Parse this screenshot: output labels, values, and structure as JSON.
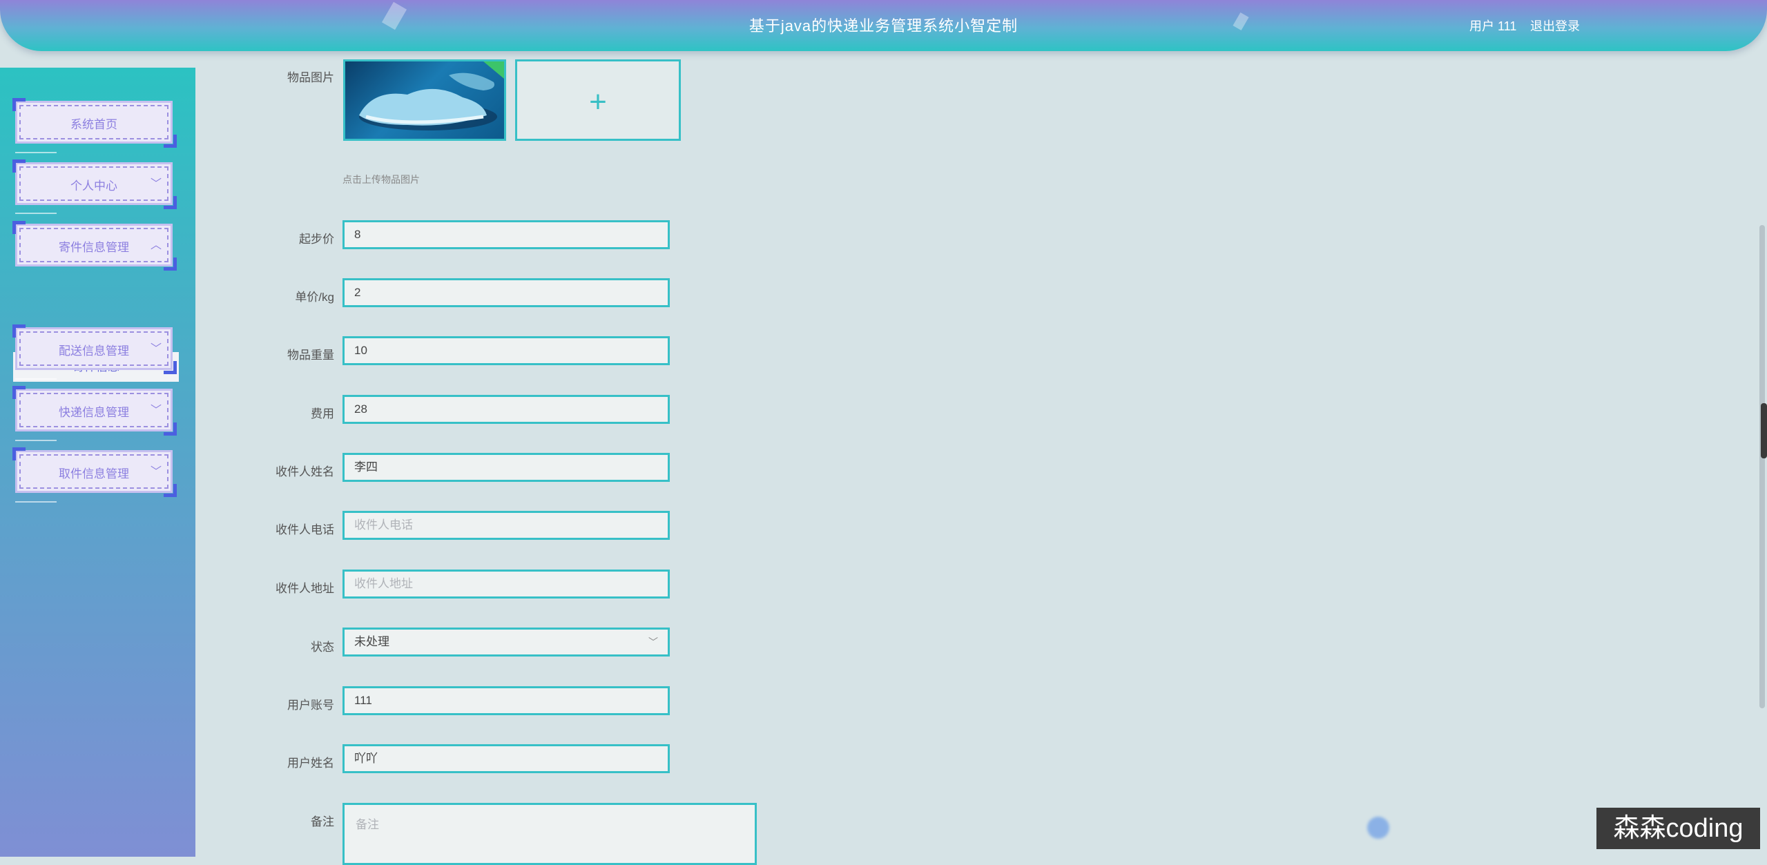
{
  "header": {
    "title": "基于java的快递业务管理系统小智定制",
    "user": "用户 111",
    "logout": "退出登录"
  },
  "sidebar": {
    "items": [
      {
        "label": "系统首页"
      },
      {
        "label": "个人中心",
        "chevron": "chevron-down-icon"
      },
      {
        "label": "寄件信息管理",
        "chevron": "chevron-up-icon"
      },
      {
        "label": "配送信息管理",
        "chevron": "chevron-down-icon"
      },
      {
        "label": "快递信息管理",
        "chevron": "chevron-down-icon"
      },
      {
        "label": "取件信息管理",
        "chevron": "chevron-down-icon"
      }
    ],
    "submenu": "寄件信息"
  },
  "form": {
    "image_label": "物品图片",
    "upload_hint": "点击上传物品图片",
    "upload_icon": "plus-icon",
    "fields": [
      {
        "label": "起步价",
        "value": "8"
      },
      {
        "label": "单价/kg",
        "value": "2"
      },
      {
        "label": "物品重量",
        "value": "10"
      },
      {
        "label": "费用",
        "value": "28"
      },
      {
        "label": "收件人姓名",
        "value": "李四"
      },
      {
        "label": "收件人电话",
        "placeholder": "收件人电话"
      },
      {
        "label": "收件人地址",
        "placeholder": "收件人地址"
      },
      {
        "label": "状态",
        "value": "未处理"
      },
      {
        "label": "用户账号",
        "value": "111"
      },
      {
        "label": "用户姓名",
        "value": "吖吖"
      }
    ],
    "notes_label": "备注",
    "notes_placeholder": "备注"
  },
  "watermark": "森森coding",
  "colors": {
    "accent": "#37c0c7",
    "menu_text": "#8c7fe0",
    "corner": "#4b5fe0"
  }
}
